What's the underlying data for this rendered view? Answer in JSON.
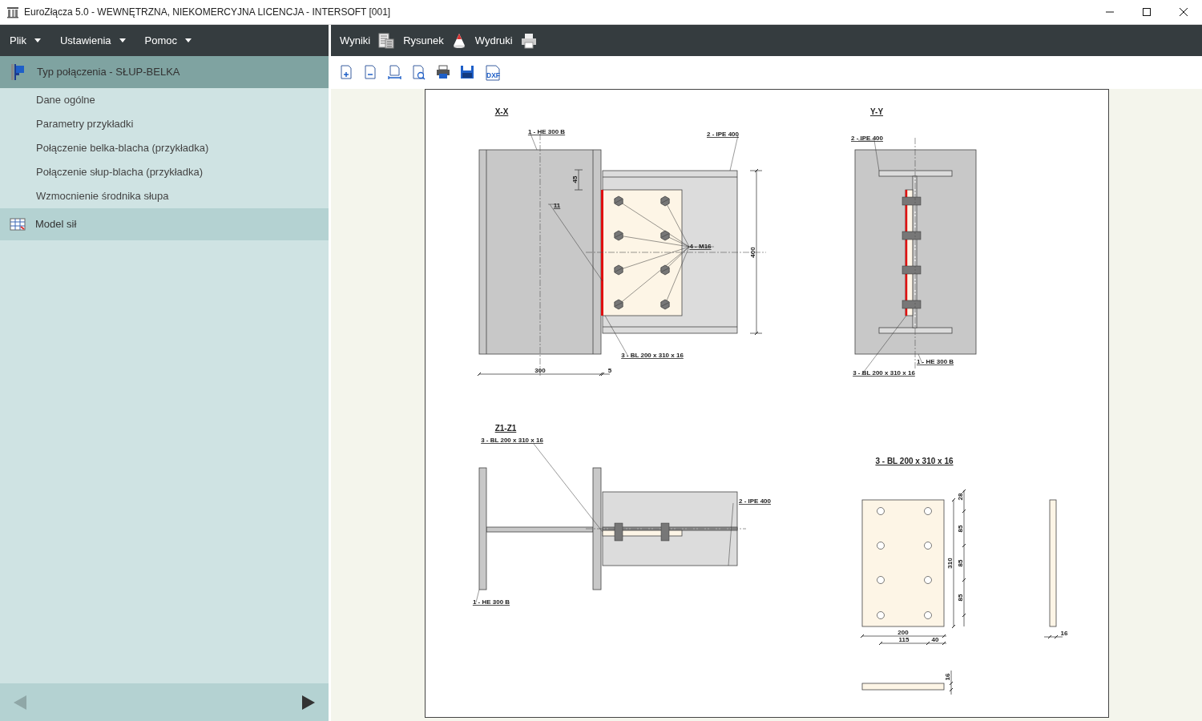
{
  "window": {
    "title": "EuroZłącza 5.0 - WEWNĘTRZNA, NIEKOMERCYJNA LICENCJA - INTERSOFT [001]"
  },
  "menu": [
    {
      "label": "Plik"
    },
    {
      "label": "Ustawienia"
    },
    {
      "label": "Pomoc"
    }
  ],
  "sidebar": {
    "groups": [
      {
        "title": "Typ połączenia - SŁUP-BELKA",
        "selected": true,
        "items": [
          {
            "label": "Dane ogólne"
          },
          {
            "label": "Parametry przykładki"
          },
          {
            "label": "Połączenie belka-blacha (przykładka)"
          },
          {
            "label": "Połączenie słup-blacha (przykładka)"
          },
          {
            "label": "Wzmocnienie środnika słupa"
          }
        ]
      },
      {
        "title": "Model sił",
        "selected": false
      }
    ]
  },
  "nav": {
    "back_disabled": true,
    "forward_disabled": false
  },
  "tabs": [
    {
      "label": "Wyniki"
    },
    {
      "label": "Rysunek"
    },
    {
      "label": "Wydruki"
    }
  ],
  "toolbar": {
    "dxf_label": "DXF"
  },
  "drawing": {
    "views": [
      {
        "kind": "elevation",
        "title": "X-X",
        "labels": [
          "1 - HE 300 B",
          "2 - IPE 400",
          "45",
          "11",
          "4 - M16",
          "400",
          "3 - BL 200 x 310 x 16",
          "300",
          "5"
        ]
      },
      {
        "kind": "side",
        "title": "Y-Y",
        "labels": [
          "2 - IPE 400",
          "1 - HE 300 B",
          "3 - BL 200 x 310 x 16"
        ]
      },
      {
        "kind": "section",
        "title": "Z1-Z1",
        "labels": [
          "3 - BL 200 x 310 x 16",
          "2 - IPE 400",
          "1 - HE 300 B"
        ]
      },
      {
        "kind": "plate",
        "title": "3 - BL 200 x 310 x 16",
        "labels": [
          "28",
          "85",
          "85",
          "85",
          "310",
          "200",
          "115",
          "40",
          "16",
          "16"
        ]
      }
    ]
  }
}
